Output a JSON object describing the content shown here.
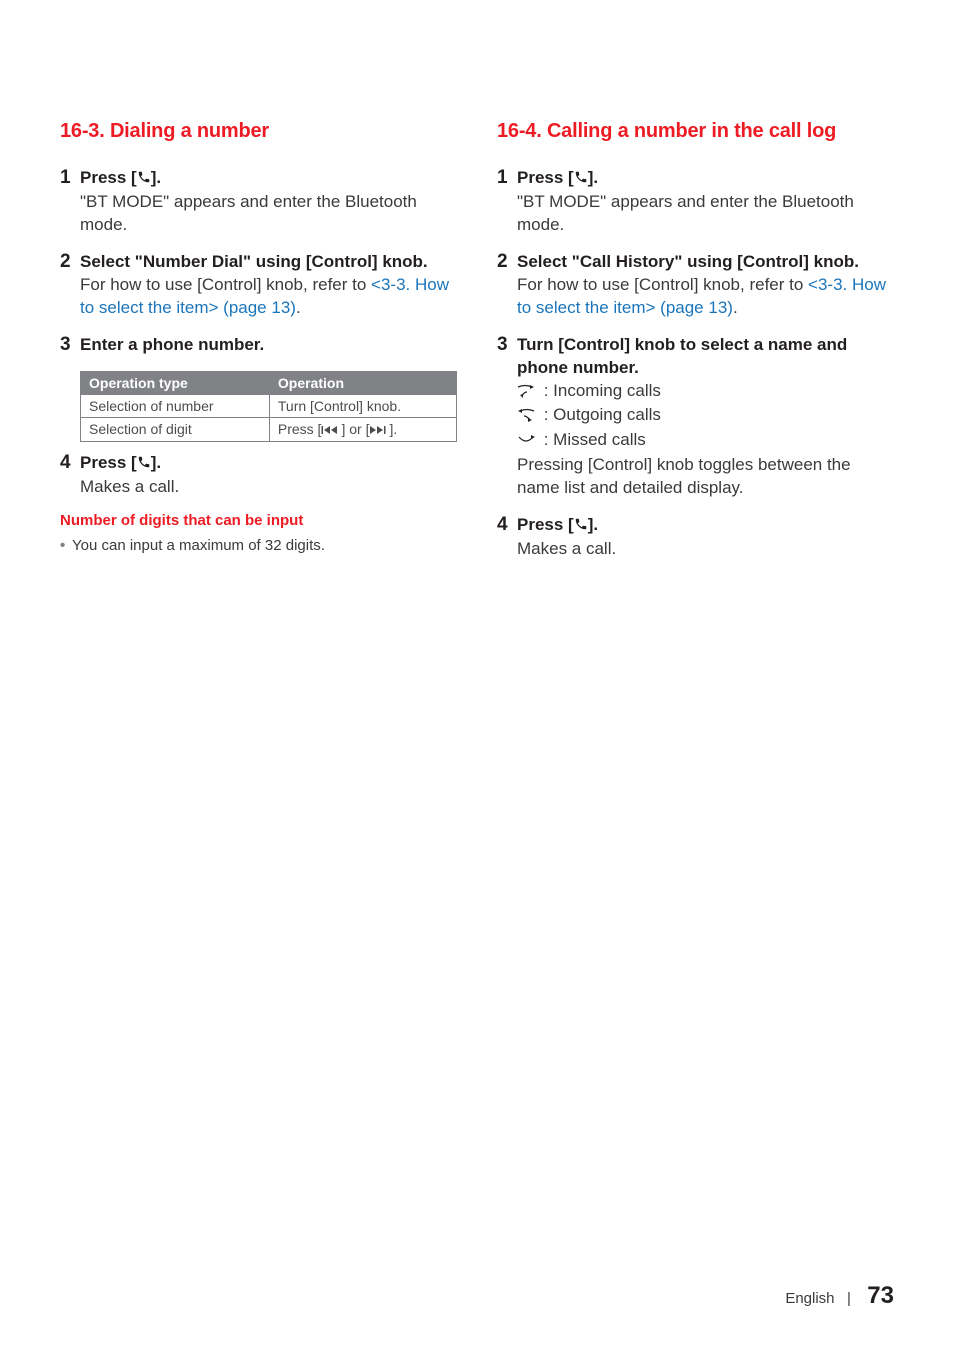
{
  "left": {
    "section_title": "16-3.  Dialing a number",
    "steps": [
      {
        "num": "1",
        "bold_pre": "Press [",
        "bold_post": "].",
        "normal": "\"BT MODE\" appears and enter the Bluetooth mode."
      },
      {
        "num": "2",
        "bold": "Select \"Number Dial\" using [Control] knob.",
        "normal_pre": "For how to use [Control] knob, refer to ",
        "link": "<3-3. How to select the item> (page 13)",
        "normal_post": "."
      },
      {
        "num": "3",
        "bold": "Enter a phone number."
      },
      {
        "num": "4",
        "bold_pre": "Press [",
        "bold_post": "].",
        "normal": "Makes a call."
      }
    ],
    "table": {
      "headers": [
        "Operation type",
        "Operation"
      ],
      "rows": [
        [
          "Selection of number",
          "Turn [Control] knob."
        ],
        [
          "Selection of digit",
          "PRESS_CTRL"
        ]
      ]
    },
    "note_title": "Number of digits that can be input",
    "note_bullet": "You can input a maximum of 32 digits."
  },
  "right": {
    "section_title": "16-4.  Calling a number in the call log",
    "steps": [
      {
        "num": "1",
        "bold_pre": "Press [",
        "bold_post": "].",
        "normal": "\"BT MODE\" appears and enter the Bluetooth mode."
      },
      {
        "num": "2",
        "bold": "Select \"Call History\" using [Control] knob.",
        "normal_pre": "For how to use [Control] knob, refer to ",
        "link": "<3-3. How to select the item> (page 13)",
        "normal_post": "."
      },
      {
        "num": "3",
        "bold": "Turn [Control] knob to select a name and phone number.",
        "call_icons": {
          "in": " : Incoming calls",
          "out": " : Outgoing calls",
          "miss": " : Missed calls"
        },
        "normal_tail": "Pressing [Control] knob toggles between the name list and detailed display."
      },
      {
        "num": "4",
        "bold_pre": "Press [",
        "bold_post": "].",
        "normal": "Makes a call."
      }
    ]
  },
  "footer": {
    "lang": "English",
    "sep": "|",
    "page": "73"
  }
}
